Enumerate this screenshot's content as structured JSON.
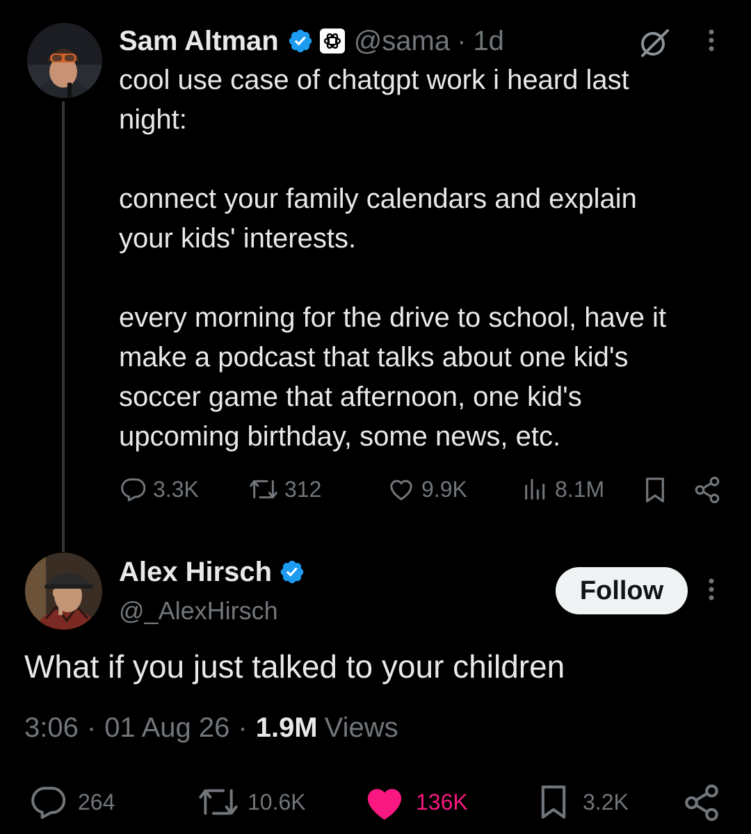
{
  "colors": {
    "background": "#000000",
    "text": "#e7e9ea",
    "muted": "#71767b",
    "verified": "#1d9bf0",
    "like_active": "#f91880",
    "thread_line": "#333639",
    "follow_bg": "#eff3f4"
  },
  "parent_tweet": {
    "author_name": "Sam Altman",
    "handle": "@sama",
    "separator": "·",
    "time": "1d",
    "verified_icon": "verified-badge-icon",
    "affiliate_icon": "openai-logo-icon",
    "grok_icon": "slash-circle-icon",
    "text": "cool use case of chatgpt work i heard last\nnight:\n\nconnect your family calendars and explain\nyour kids' interests.\n\nevery morning for the drive to school, have it\nmake a podcast that talks about one kid's\nsoccer game that afternoon, one kid's\nupcoming birthday, some news, etc.",
    "actions": {
      "replies": "3.3K",
      "reposts": "312",
      "likes": "9.9K",
      "views": "8.1M"
    }
  },
  "reply_tweet": {
    "author_name": "Alex Hirsch",
    "handle": "@_AlexHirsch",
    "verified_icon": "verified-badge-icon",
    "follow_label": "Follow",
    "text": "What if you just talked to your children",
    "meta": {
      "time": "3:06",
      "separator": "·",
      "date": "01 Aug 26",
      "views_count": "1.9M",
      "views_label": "Views"
    },
    "actions": {
      "replies": "264",
      "reposts": "10.6K",
      "likes": "136K",
      "bookmarks": "3.2K"
    }
  }
}
